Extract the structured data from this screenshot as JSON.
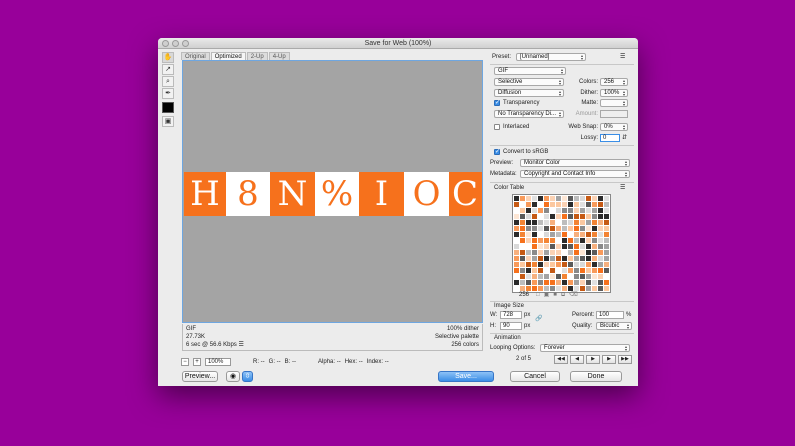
{
  "window": {
    "title": "Save for Web (100%)"
  },
  "tools": [
    {
      "name": "hand-tool",
      "glyph": "✋"
    },
    {
      "name": "slice-select-tool",
      "glyph": "↗"
    },
    {
      "name": "zoom-tool",
      "glyph": "⌕"
    },
    {
      "name": "eyedropper-tool",
      "glyph": "✒"
    }
  ],
  "tabs": [
    "Original",
    "Optimized",
    "2-Up",
    "4-Up"
  ],
  "preview_glyphs": [
    "H",
    "8",
    "N",
    "%",
    "I",
    "O",
    "C"
  ],
  "info": {
    "format": "GIF",
    "size": "27.73K",
    "time": "6 sec @ 56.6 Kbps",
    "dither": "100% dither",
    "palette": "Selective palette",
    "colors": "256 colors"
  },
  "statusbar": {
    "zoom": "100%",
    "r": "R: --",
    "g": "G: --",
    "b": "B: --",
    "alpha": "Alpha: --",
    "hex": "Hex: --",
    "index": "Index: --"
  },
  "buttons": {
    "preview": "Preview...",
    "save": "Save...",
    "cancel": "Cancel",
    "done": "Done"
  },
  "settings": {
    "preset_label": "Preset:",
    "preset_value": "[Unnamed]",
    "format": "GIF",
    "reduction": "Selective",
    "dither_algo": "Diffusion",
    "colors_label": "Colors:",
    "colors": "256",
    "dither_label": "Dither:",
    "dither": "100%",
    "transparency_label": "Transparency",
    "matte_label": "Matte:",
    "transparency_dither": "No Transparency Di...",
    "amount_label": "Amount:",
    "interlaced_label": "Interlaced",
    "websnap_label": "Web Snap:",
    "websnap": "0%",
    "lossy_label": "Lossy:",
    "lossy": "0",
    "convert_srgb_label": "Convert to sRGB",
    "preview_label": "Preview:",
    "preview_value": "Monitor Color",
    "metadata_label": "Metadata:",
    "metadata_value": "Copyright and Contact Info"
  },
  "color_table": {
    "title": "Color Table",
    "count": "256"
  },
  "image_size": {
    "title": "Image Size",
    "w_label": "W:",
    "w": "728",
    "h_label": "H:",
    "h": "90",
    "unit": "px",
    "percent_label": "Percent:",
    "percent": "100",
    "percent_unit": "%",
    "quality_label": "Quality:",
    "quality": "Bicubic"
  },
  "animation": {
    "title": "Animation",
    "looping_label": "Looping Options:",
    "looping": "Forever",
    "frame": "2 of 5"
  },
  "colors": {
    "background": "#98009a",
    "accent_orange": "#f6711c",
    "selection_blue": "#3b8ee6"
  }
}
